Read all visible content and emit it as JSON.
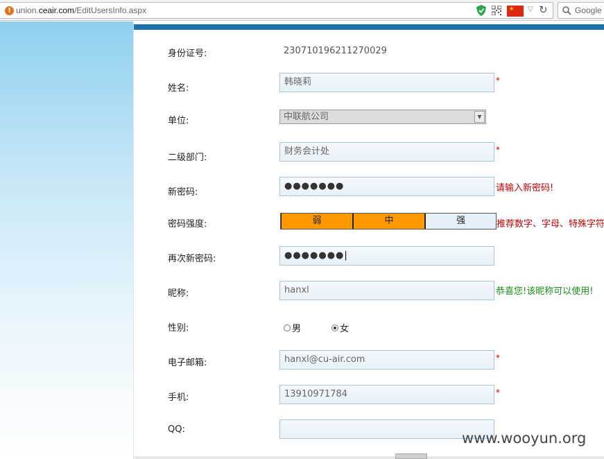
{
  "browser": {
    "url_prefix": "union.",
    "url_domain": "ceair.com",
    "url_path": "/EditUsersInfo.aspx",
    "search_placeholder": "Google"
  },
  "form": {
    "id_number": {
      "label": "身份证号:",
      "value": "230710196211270029"
    },
    "name": {
      "label": "姓名:",
      "value": "韩晓莉",
      "required": "*"
    },
    "unit": {
      "label": "单位:",
      "value": "中联航公司"
    },
    "department": {
      "label": "二级部门:",
      "value": "财务会计处",
      "required": "*"
    },
    "new_password": {
      "label": "新密码:",
      "value": "●●●●●●●",
      "message": "请输入新密码!"
    },
    "strength": {
      "label": "密码强度:",
      "weak": "弱",
      "medium": "中",
      "strong": "强",
      "message": "推荐数字、字母、特殊字符"
    },
    "confirm_password": {
      "label": "再次新密码:",
      "value": "●●●●●●●"
    },
    "nickname": {
      "label": "昵称:",
      "value": "hanxl",
      "message": "恭喜您!该昵称可以使用!"
    },
    "gender": {
      "label": "性别:",
      "male": "男",
      "female": "女",
      "selected": "女"
    },
    "email": {
      "label": "电子邮箱:",
      "value": "hanxl@cu-air.com",
      "required": "*"
    },
    "mobile": {
      "label": "手机:",
      "value": "13910971784",
      "required": "*"
    },
    "qq": {
      "label": "QQ:",
      "value": ""
    }
  },
  "watermark": "www.wooyun.org",
  "colors": {
    "top_strip": "#1e6fae",
    "strength_active": "#ff9900",
    "error": "#c00000",
    "success": "#1a8a1a"
  }
}
